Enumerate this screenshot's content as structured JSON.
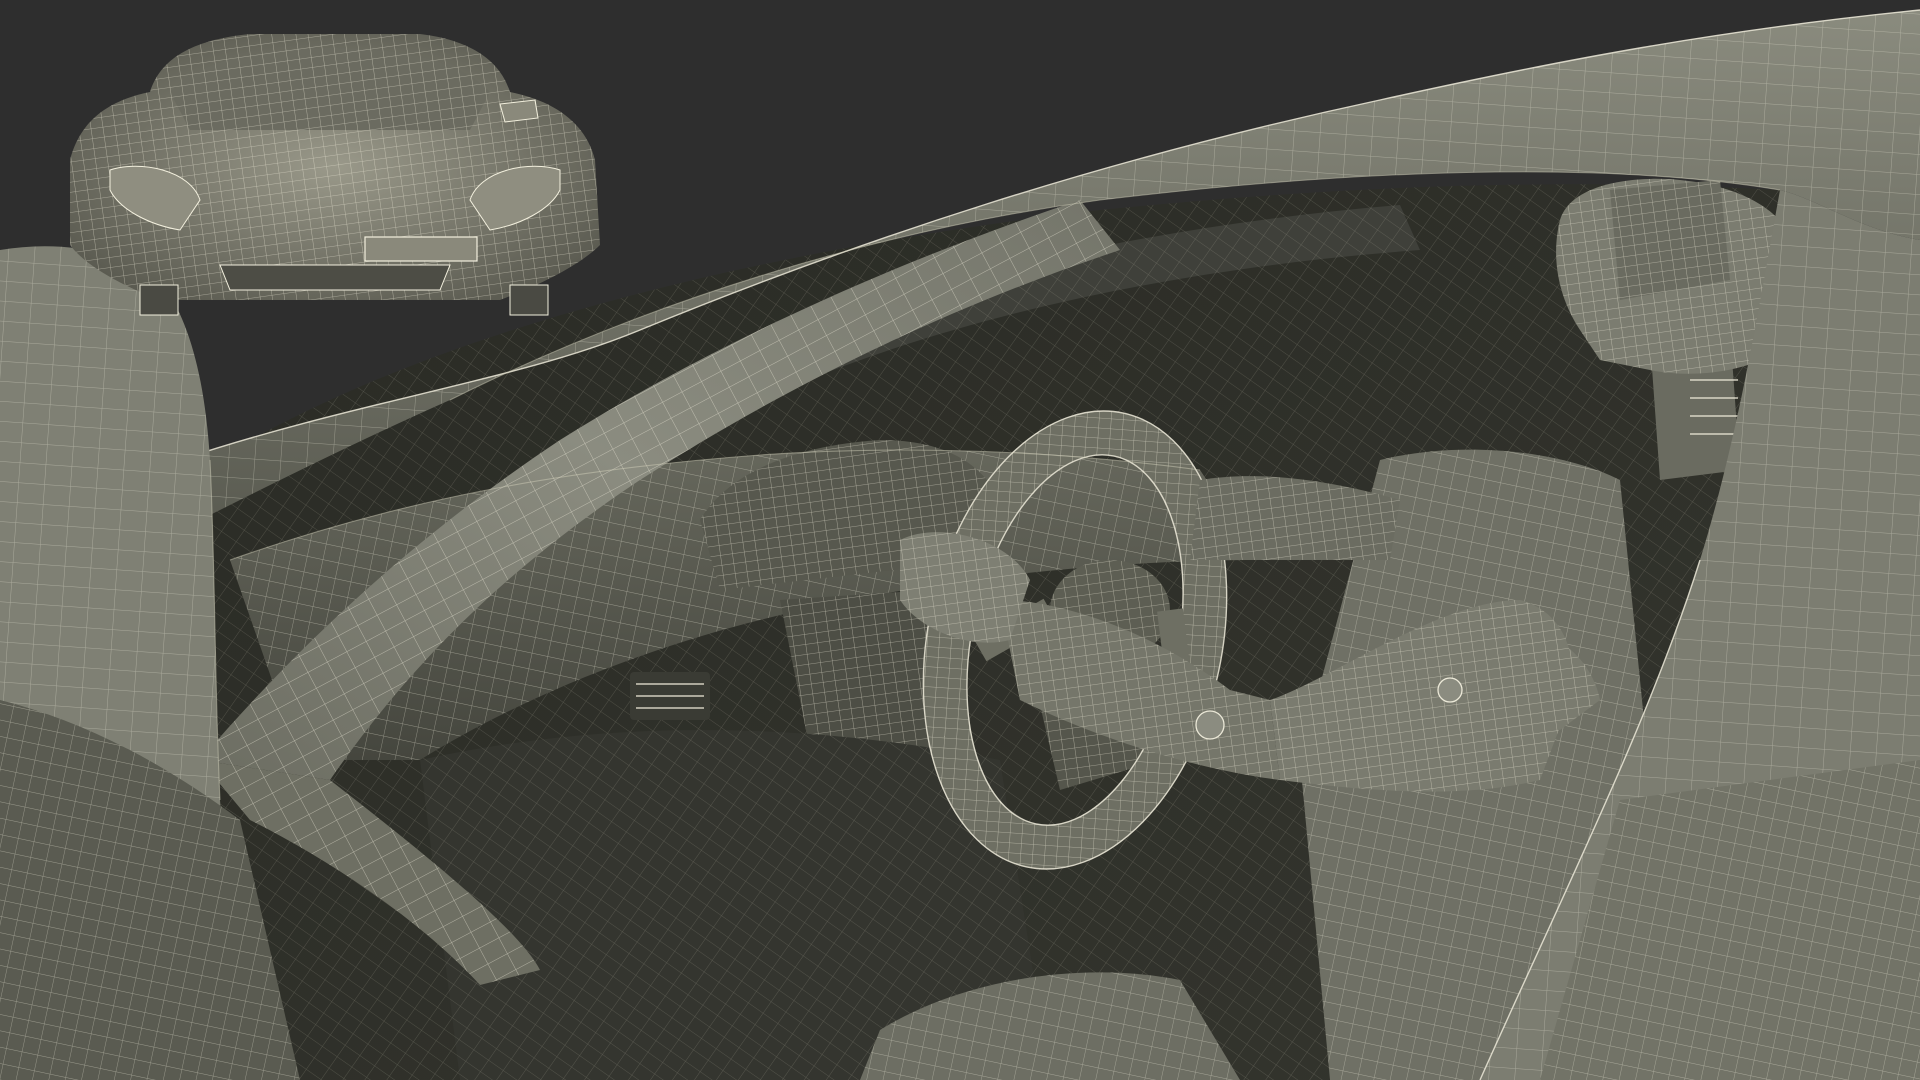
{
  "scene": {
    "colors": {
      "background": "#2e2e2e",
      "surface_light": "#7d7e71",
      "surface_mid": "#5f6056",
      "surface_dark": "#3b3c35",
      "interior_shadow": "#23241f",
      "wire": "#ece9d8"
    },
    "objects": [
      "car-body-wireframe",
      "a-pillar-wireframe",
      "dashboard-wireframe",
      "steering-wheel-wireframe",
      "driver-mannequin-wireframe",
      "preview-car-front-wireframe"
    ]
  }
}
